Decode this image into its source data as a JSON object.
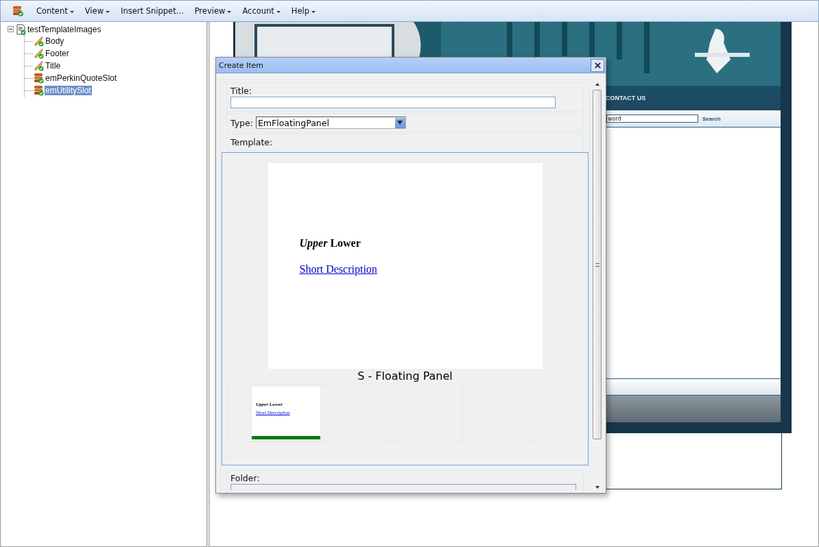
{
  "menu": [
    {
      "label": "Content",
      "dropdown": true
    },
    {
      "label": "View",
      "dropdown": true
    },
    {
      "label": "Insert Snippet...",
      "dropdown": false
    },
    {
      "label": "Preview",
      "dropdown": true
    },
    {
      "label": "Account",
      "dropdown": true
    },
    {
      "label": "Help",
      "dropdown": true
    }
  ],
  "tree": {
    "label": "testTemplateImages",
    "expanded": true,
    "children": [
      {
        "label": "Body",
        "kind": "field",
        "selected": false
      },
      {
        "label": "Footer",
        "kind": "field",
        "selected": false
      },
      {
        "label": "Title",
        "kind": "field",
        "selected": false
      },
      {
        "label": "emPerkinQuoteSlot",
        "kind": "slot",
        "selected": false
      },
      {
        "label": "emUtilitySlot",
        "kind": "slot",
        "selected": true
      }
    ]
  },
  "preview_page": {
    "nav": [
      "CONTACT US"
    ],
    "search": {
      "placeholder": "word",
      "button": "Search"
    }
  },
  "dialog": {
    "title": "Create Item",
    "title_field": {
      "label": "Title:"
    },
    "type_field": {
      "label": "Type:",
      "value": "EmFloatingPanel"
    },
    "template": {
      "label": "Template:",
      "heading": "*Upper* Lower",
      "link": "Short Description",
      "caption": "S - Floating Panel",
      "thumbnails": [
        {
          "kind": "empty"
        },
        {
          "kind": "template",
          "heading": "*Upper* Lower",
          "link": "Short Description",
          "selected": true
        },
        {
          "kind": "empty"
        },
        {
          "kind": "empty"
        },
        {
          "kind": "empty"
        },
        {
          "kind": "empty"
        }
      ]
    },
    "folder_field": {
      "label": "Folder:"
    }
  }
}
